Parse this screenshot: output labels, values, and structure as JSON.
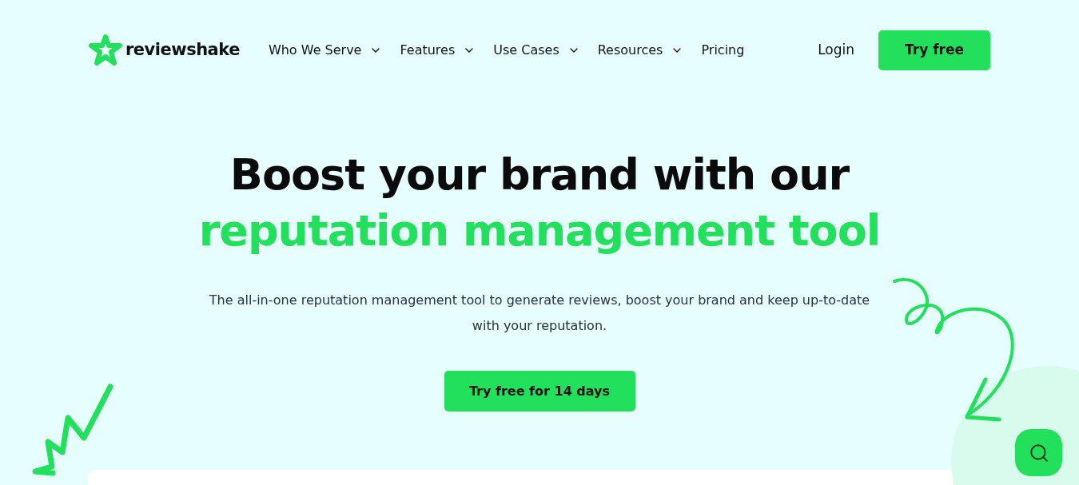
{
  "brand": {
    "name": "reviewshake"
  },
  "nav": {
    "items": [
      {
        "label": "Who We Serve",
        "has_dropdown": true
      },
      {
        "label": "Features",
        "has_dropdown": true
      },
      {
        "label": "Use Cases",
        "has_dropdown": true
      },
      {
        "label": "Resources",
        "has_dropdown": true
      },
      {
        "label": "Pricing",
        "has_dropdown": false
      }
    ],
    "login": "Login",
    "cta": "Try free"
  },
  "hero": {
    "title_line_1": "Boost your brand with our",
    "title_line_2": "reputation management tool",
    "subtitle": "The all-in-one reputation management tool to generate reviews, boost your brand and keep up-to-date with your reputation.",
    "cta": "Try free for 14 days"
  }
}
